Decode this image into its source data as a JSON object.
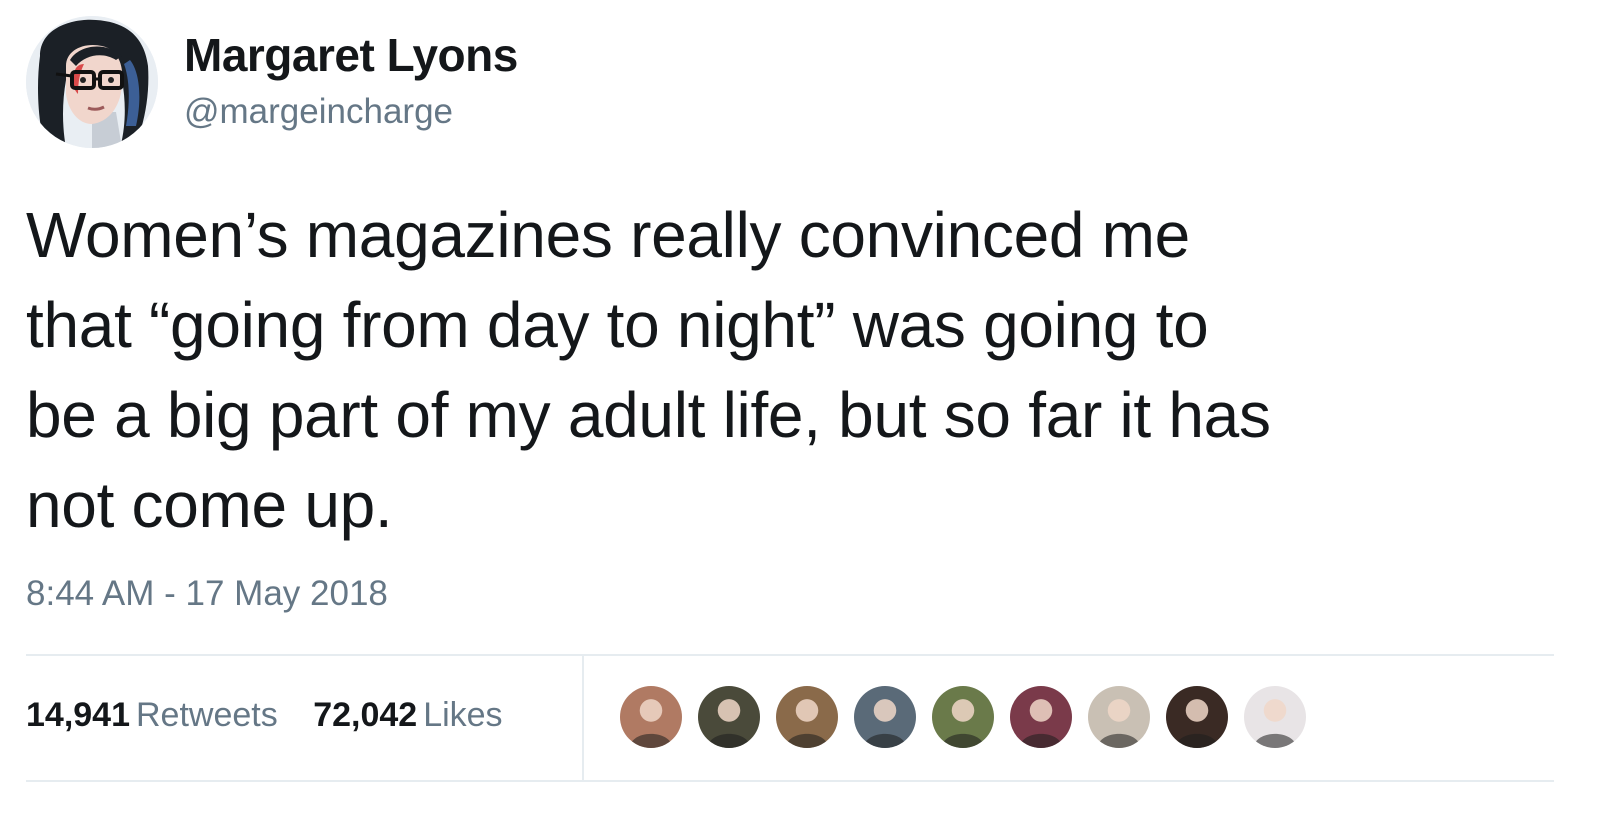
{
  "author": {
    "name": "Margaret Lyons",
    "handle": "@margeincharge",
    "avatar_icon": "illustrated-portrait-avatar"
  },
  "tweet": {
    "lines": [
      "Women’s magazines really convinced me",
      "that “going from day to night” was going to",
      "be a big part of my adult life, but so far it has",
      "not come up."
    ],
    "timestamp": "8:44 AM - 17 May 2018"
  },
  "stats": {
    "retweets_count": "14,941",
    "retweets_label": "Retweets",
    "likes_count": "72,042",
    "likes_label": "Likes"
  },
  "likers": [
    {
      "name": "liker-avatar-1",
      "color": "#b07a63"
    },
    {
      "name": "liker-avatar-2",
      "color": "#4a4a3a"
    },
    {
      "name": "liker-avatar-3",
      "color": "#8a6a4a"
    },
    {
      "name": "liker-avatar-4",
      "color": "#5a6a78"
    },
    {
      "name": "liker-avatar-5",
      "color": "#6a7a4a"
    },
    {
      "name": "liker-avatar-6",
      "color": "#7a3a4a"
    },
    {
      "name": "liker-avatar-7",
      "color": "#c9c0b4"
    },
    {
      "name": "liker-avatar-8",
      "color": "#3a2a24"
    },
    {
      "name": "liker-avatar-9",
      "color": "#e8e4e6"
    }
  ],
  "colors": {
    "text_primary": "#14171a",
    "text_secondary": "#657786",
    "divider": "#e6ecf0"
  }
}
